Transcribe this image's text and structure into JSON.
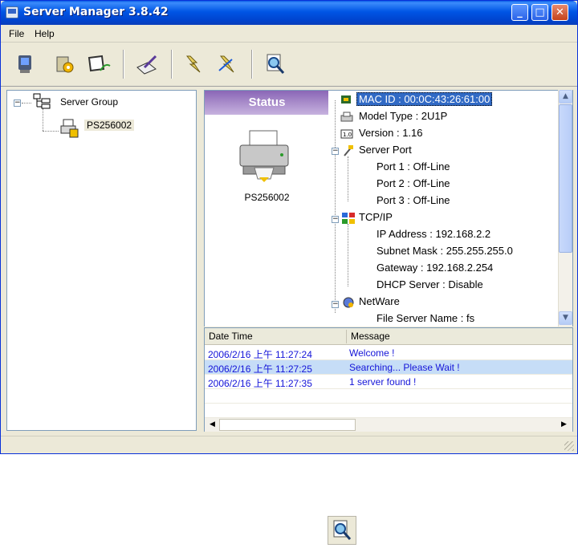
{
  "window": {
    "title": "Server Manager 3.8.42",
    "controls": {
      "minimize": "_",
      "maximize": "□",
      "close": "✕"
    }
  },
  "menubar": {
    "items": [
      "File",
      "Help"
    ]
  },
  "toolbar": {
    "buttons": [
      {
        "name": "computer-icon"
      },
      {
        "name": "gear-config-icon"
      },
      {
        "name": "monitor-wave-icon"
      },
      {
        "name": "edit-pen-icon"
      },
      {
        "name": "flash-icon"
      },
      {
        "name": "flash-arrow-icon"
      },
      {
        "name": "magnifier-icon"
      }
    ]
  },
  "tree": {
    "root": "Server Group",
    "child": "PS256002"
  },
  "status": {
    "header": "Status",
    "device_name": "PS256002"
  },
  "properties": {
    "mac": "MAC ID : 00:0C:43:26:61:00",
    "model": "Model Type : 2U1P",
    "version": "Version : 1.16",
    "server_port": "Server Port",
    "port1": "Port 1 : Off-Line",
    "port2": "Port 2 : Off-Line",
    "port3": "Port 3 : Off-Line",
    "tcpip": "TCP/IP",
    "ip": "IP Address : 192.168.2.2",
    "subnet": "Subnet Mask : 255.255.255.0",
    "gateway": "Gateway : 192.168.2.254",
    "dhcp": "DHCP Server : Disable",
    "netware": "NetWare",
    "file_server": "File Server Name : fs"
  },
  "log": {
    "columns": [
      "Date Time",
      "Message"
    ],
    "rows": [
      {
        "time": "2006/2/16 上午 11:27:24",
        "message": "Welcome !"
      },
      {
        "time": "2006/2/16 上午 11:27:25",
        "message": "Searching... Please Wait !"
      },
      {
        "time": "2006/2/16 上午 11:27:35",
        "message": "1 server found !"
      }
    ]
  },
  "colors": {
    "titlebar": "#0055e5",
    "selection": "#316ac5",
    "status_header": "#8a66b6",
    "log_text": "#1414d8",
    "log_highlight": "#c6ddf7"
  }
}
